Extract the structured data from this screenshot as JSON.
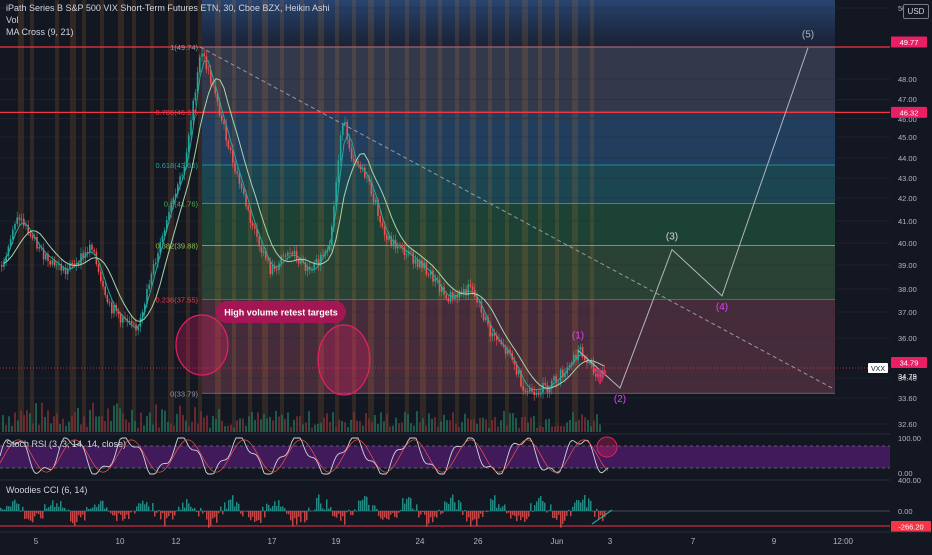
{
  "header": {
    "title": "iPath Series B S&P 500 VIX Short-Term Futures ETN, 30, Cboe BZX, Heikin Ashi",
    "vol_label": "Vol",
    "ma_label": "MA Cross (9, 21)",
    "currency": "USD"
  },
  "annotation": {
    "callout": "High volume retest targets"
  },
  "waves": [
    "(1)",
    "(2)",
    "(3)",
    "(4)",
    "(5)"
  ],
  "fib_levels": [
    {
      "label": "1(49.74)",
      "value": 49.74
    },
    {
      "label": "0.786(46.37)",
      "value": 46.37
    },
    {
      "label": "0.618(43.65)",
      "value": 43.65
    },
    {
      "label": "0.5(41.76)",
      "value": 41.76
    },
    {
      "label": "0.382(39.88)",
      "value": 39.88
    },
    {
      "label": "0.236(37.55)",
      "value": 37.55
    },
    {
      "label": "0(33.79)",
      "value": 33.79
    }
  ],
  "price_badges": [
    {
      "label": "49.77",
      "value": 49.77,
      "color": "#e91e63"
    },
    {
      "label": "46.32",
      "value": 46.32,
      "color": "#e91e63"
    },
    {
      "label": "34.79",
      "value": 34.79,
      "color": "#e91e63"
    },
    {
      "label": "VXX",
      "value": 34.79,
      "color": "#ffffff"
    }
  ],
  "indicators": {
    "stoch": {
      "label": "Stoch RSI (3, 3, 14, 14, close)",
      "ticks": [
        "100.00",
        "0.00"
      ]
    },
    "cci": {
      "label": "Woodies CCI (6, 14)",
      "ticks": [
        "400.00",
        "0.00",
        "-266.20"
      ]
    }
  },
  "chart_data": {
    "type": "candlestick",
    "y_axis_ticks": [
      "50.00",
      "48.00",
      "47.00",
      "46.00",
      "45.00",
      "44.00",
      "43.00",
      "42.00",
      "41.00",
      "40.00",
      "39.00",
      "38.00",
      "37.00",
      "36.00",
      "34.40",
      "33.60",
      "32.60"
    ],
    "x_axis_ticks": [
      "5",
      "10",
      "12",
      "17",
      "19",
      "24",
      "26",
      "Jun",
      "3",
      "7",
      "9",
      "12:00"
    ],
    "price_path": [
      {
        "t": 0,
        "p": 39.0
      },
      {
        "t": 18,
        "p": 41.2
      },
      {
        "t": 40,
        "p": 39.6
      },
      {
        "t": 65,
        "p": 38.7
      },
      {
        "t": 90,
        "p": 39.8
      },
      {
        "t": 110,
        "p": 37.2
      },
      {
        "t": 135,
        "p": 36.2
      },
      {
        "t": 150,
        "p": 38.4
      },
      {
        "t": 168,
        "p": 41.5
      },
      {
        "t": 185,
        "p": 43.8
      },
      {
        "t": 200,
        "p": 49.7
      },
      {
        "t": 212,
        "p": 47.6
      },
      {
        "t": 230,
        "p": 44.2
      },
      {
        "t": 250,
        "p": 41.0
      },
      {
        "t": 270,
        "p": 38.7
      },
      {
        "t": 290,
        "p": 39.6
      },
      {
        "t": 310,
        "p": 38.6
      },
      {
        "t": 330,
        "p": 40.2
      },
      {
        "t": 343,
        "p": 46.4
      },
      {
        "t": 350,
        "p": 43.8
      },
      {
        "t": 365,
        "p": 43.2
      },
      {
        "t": 385,
        "p": 40.2
      },
      {
        "t": 410,
        "p": 39.4
      },
      {
        "t": 430,
        "p": 38.6
      },
      {
        "t": 445,
        "p": 37.6
      },
      {
        "t": 470,
        "p": 38.0
      },
      {
        "t": 490,
        "p": 36.2
      },
      {
        "t": 510,
        "p": 35.2
      },
      {
        "t": 525,
        "p": 33.9
      },
      {
        "t": 545,
        "p": 34.0
      },
      {
        "t": 562,
        "p": 34.6
      },
      {
        "t": 578,
        "p": 35.5
      },
      {
        "t": 595,
        "p": 34.5
      },
      {
        "t": 605,
        "p": 34.8
      }
    ],
    "wave_projection": [
      {
        "t": 578,
        "p": 35.5,
        "label": "(1)"
      },
      {
        "t": 620,
        "p": 34.0,
        "label": "(2)"
      },
      {
        "t": 672,
        "p": 39.7,
        "label": "(3)"
      },
      {
        "t": 722,
        "p": 37.7,
        "label": "(4)"
      },
      {
        "t": 808,
        "p": 49.7,
        "label": "(5)"
      }
    ],
    "trendline": [
      {
        "t": 200,
        "p": 49.74
      },
      {
        "t": 832,
        "p": 34.0
      }
    ],
    "ylim": [
      32.4,
      51.0
    ]
  }
}
